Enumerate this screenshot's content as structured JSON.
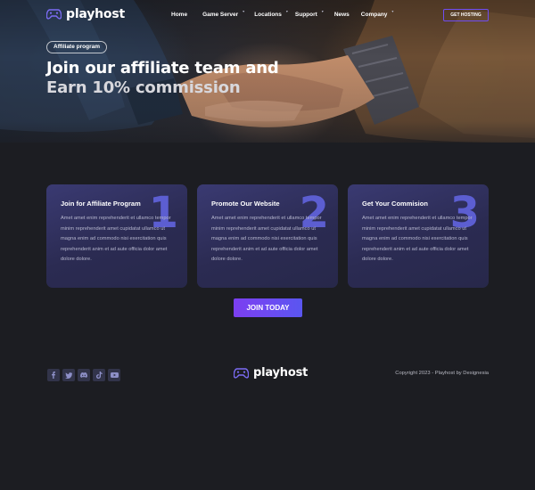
{
  "brand": {
    "name": "playhost",
    "accent": "#6f4df2",
    "logo_icon": "gamepad-icon"
  },
  "nav": {
    "items": [
      {
        "label": "Home",
        "has_dropdown": false
      },
      {
        "label": "Game Server",
        "has_dropdown": true
      },
      {
        "label": "Locations",
        "has_dropdown": true
      },
      {
        "label": "Support",
        "has_dropdown": true
      },
      {
        "label": "News",
        "has_dropdown": false
      },
      {
        "label": "Company",
        "has_dropdown": true
      }
    ],
    "cta_label": "GET HOSTING"
  },
  "hero": {
    "tag": "Affiliate program",
    "title_line1": "Join our affiliate team and",
    "title_line2": "Earn 10% commission"
  },
  "cards": [
    {
      "number": "1",
      "title": "Join for Affiliate Program",
      "body": "Amet amet enim reprehenderit et ullamco tempor minim reprehenderit amet cupidatat ullamco ut magna enim ad commodo nisi exercitation quis reprehenderit anim et ad aute officia dolor amet dolore dolore."
    },
    {
      "number": "2",
      "title": "Promote Our Website",
      "body": "Amet amet enim reprehenderit et ullamco tempor minim reprehenderit amet cupidatat ullamco ut magna enim ad commodo nisi exercitation quis reprehenderit anim et ad aute officia dolor amet dolore dolore."
    },
    {
      "number": "3",
      "title": "Get Your Commision",
      "body": "Amet amet enim reprehenderit et ullamco tempor minim reprehenderit amet cupidatat ullamco ut magna enim ad commodo nisi exercitation quis reprehenderit anim et ad aute officia dolor amet dolore dolore."
    }
  ],
  "cta": {
    "label": "JOIN TODAY"
  },
  "footer": {
    "socials": [
      "facebook-icon",
      "twitter-icon",
      "discord-icon",
      "tiktok-icon",
      "youtube-icon"
    ],
    "copyright": "Copyright 2023 - Playhost by Designesia"
  },
  "colors": {
    "background": "#1c1d22",
    "card": "#2e2e58",
    "card_number": "#5c5ed1"
  }
}
